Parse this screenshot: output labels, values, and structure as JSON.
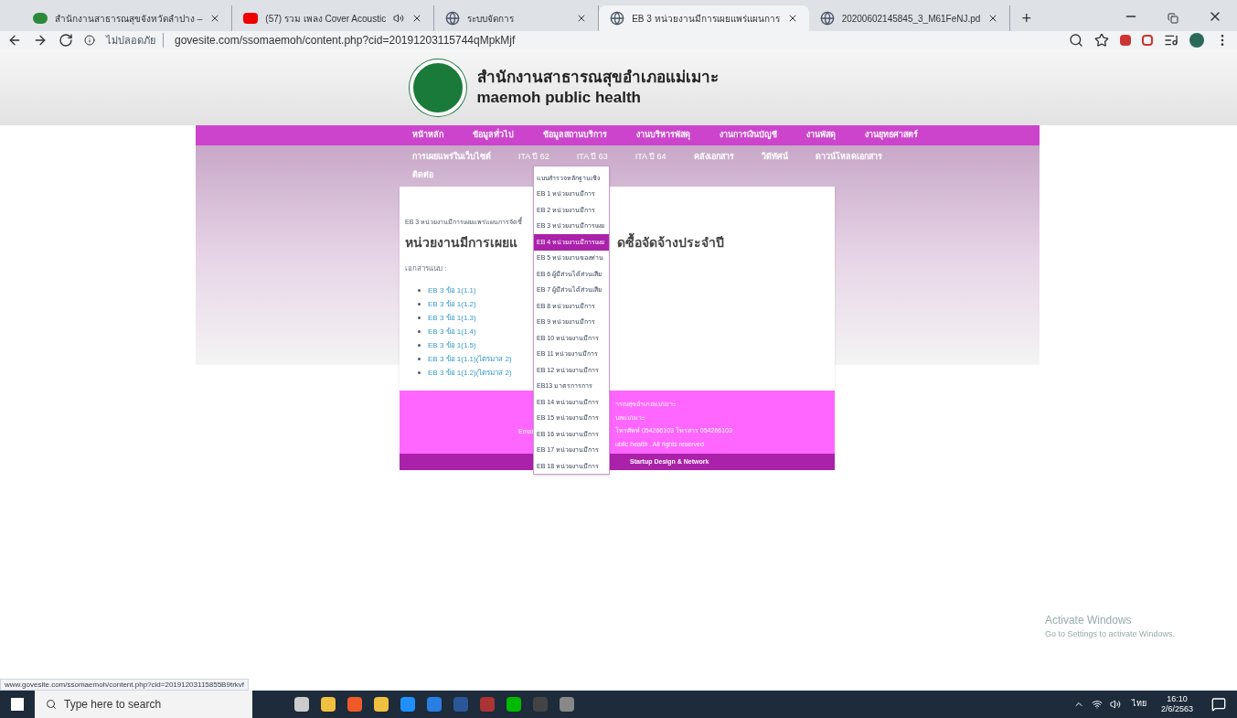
{
  "browser": {
    "tabs": [
      {
        "title": "สำนักงานสาธารณสุขจังหวัดลำปาง –",
        "kind": "site",
        "audio": false,
        "selected": false
      },
      {
        "title": "(57) รวม เพลง Cover Acoustic",
        "kind": "video",
        "audio": true,
        "selected": false
      },
      {
        "title": "ระบบจัดการ",
        "kind": "web",
        "audio": false,
        "selected": false
      },
      {
        "title": "EB 3 หน่วยงานมีการเผยแพร่แผนการ",
        "kind": "web",
        "audio": false,
        "selected": true
      },
      {
        "title": "20200602145845_3_M61FeNJ.pd",
        "kind": "web",
        "audio": false,
        "selected": false
      }
    ],
    "new_tab": "+",
    "security": "ไม่ปลอดภัย",
    "url": "govesite.com/ssomaemoh/content.php?cid=20191203115744qMpkMjf"
  },
  "site": {
    "title": "สำนักงานสาธารณสุขอำเภอแม่เมาะ",
    "subtitle": "maemoh public health",
    "menu_row_1": [
      "หน้าหลัก",
      "ข้อมูลทั่วไป",
      "ข้อมูลสถานบริการ",
      "งานบริหารพัสดุ",
      "งานการเงินบัญชี",
      "งานพัสดุ",
      "งานยุทธศาสตร์"
    ],
    "menu_row_2": [
      {
        "label": "การเผยแพร่ในเว็บไซต์",
        "bold": true
      },
      {
        "label": "ITA ปี 62",
        "bold": false
      },
      {
        "label": "ITA ปี 63",
        "bold": false
      },
      {
        "label": "ITA ปี 64",
        "bold": false
      },
      {
        "label": "คลังเอกสาร",
        "bold": true
      },
      {
        "label": "วิดีทัศน์",
        "bold": true
      },
      {
        "label": "ดาวน์โหลดเอกสาร",
        "bold": true
      }
    ],
    "menu_row_3": [
      "ติดต่อ"
    ],
    "breadcrumb": "EB 3 หน่วยงานมีการเผยแพร่แผนการจัดซื้",
    "heading_parts": [
      "หน่วยงานมีการเผยแ",
      "ดซื้อจัดจ้างประจำปี"
    ],
    "attachments_label": "เอกสารแนบ :",
    "attachments": [
      "EB 3 ข้อ 1(1.1)",
      "EB 3 ข้อ 1(1.2)",
      "EB 3 ข้อ 1(1.3)",
      "EB 3 ข้อ 1(1.4)",
      "EB 3 ข้อ 1(1.5)",
      "EB 3 ข้อ 1(1.1)(ไตรมาส 2)",
      "EB 3 ข้อ 1(1.2)(ไตรมาส 2)"
    ],
    "dropdown": [
      {
        "label": "แบบสำรวจหลักฐานเชิง",
        "selected": false
      },
      {
        "label": "EB 1 หน่วยงานมีการ",
        "selected": false
      },
      {
        "label": "EB 2 หน่วยงานมีการ",
        "selected": false
      },
      {
        "label": "EB 3 หน่วยงานมีการเผย",
        "selected": false
      },
      {
        "label": "EB 4 หน่วยงานมีการเผย",
        "selected": true
      },
      {
        "label": "EB 5 หน่วยงานของท่าน",
        "selected": false
      },
      {
        "label": "EB 6 ผู้มีส่วนได้ส่วนเสีย",
        "selected": false
      },
      {
        "label": "EB 7 ผู้มีส่วนได้ส่วนเสีย",
        "selected": false
      },
      {
        "label": "EB 8 หน่วยงานมีการ",
        "selected": false
      },
      {
        "label": "EB 9 หน่วยงานมีการ",
        "selected": false
      },
      {
        "label": "EB 10 หน่วยงานมีการ",
        "selected": false
      },
      {
        "label": "EB 11 หน่วยงานมีการ",
        "selected": false
      },
      {
        "label": "EB 12 หน่วยงานมีการ",
        "selected": false
      },
      {
        "label": "EB13 มาตรการการ",
        "selected": false
      },
      {
        "label": "EB 14 หน่วยงานมีการ",
        "selected": false
      },
      {
        "label": "EB 15 หน่วยงานมีการ",
        "selected": false
      },
      {
        "label": "EB 16 หน่วยงานมีการ",
        "selected": false
      },
      {
        "label": "EB 17 หน่วยงานมีการ",
        "selected": false
      },
      {
        "label": "EB 18 หน่วยงานมีการ",
        "selected": false
      }
    ],
    "footer_lines": [
      "ารณสุขอำเภอแม่เมาะ",
      "บลแม่เมาะ",
      "โทรศัพท์ 054266103 โทรสาร 054266103",
      "ublic health . All rights reserved"
    ],
    "footer_left": "Emai",
    "credit": "Startup Design & Network"
  },
  "status_url": "www.govesite.com/ssomaemoh/content.php?cid=20191203115855B9trkvf",
  "watermark": {
    "title": "Activate Windows",
    "text": "Go to Settings to activate Windows."
  },
  "taskbar": {
    "search": "Type here to search",
    "time": "16:10",
    "date": "2/6/2563",
    "lang": "ไทย"
  }
}
